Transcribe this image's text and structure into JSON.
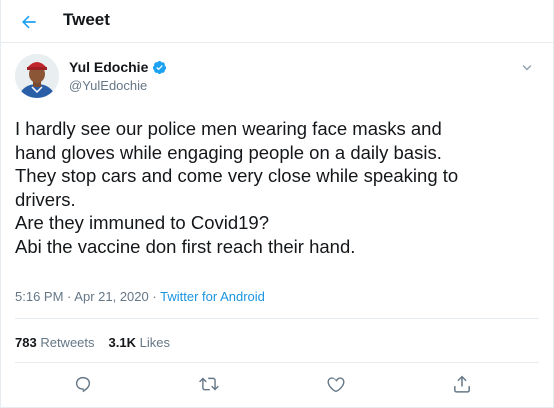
{
  "header": {
    "title": "Tweet",
    "back_icon": "arrow-left-icon"
  },
  "colors": {
    "accent": "#1b95e0",
    "text": "#14171a",
    "muted": "#657786",
    "border": "#e6ecf0"
  },
  "tweet": {
    "author": {
      "name": "Yul Edochie",
      "handle": "@YulEdochie",
      "verified": true
    },
    "text_lines": [
      "I hardly see our police men wearing face masks and",
      "hand gloves while engaging people on a daily basis.",
      "They stop cars and come very close while speaking to",
      "drivers.",
      "Are they immuned to Covid19?",
      "Abi the vaccine don first reach their hand."
    ],
    "time": "5:16 PM",
    "date": "Apr 21, 2020",
    "separator": "·",
    "source": "Twitter for Android",
    "stats": {
      "retweets_count": "783",
      "retweets_label": "Retweets",
      "likes_count": "3.1K",
      "likes_label": "Likes"
    },
    "actions": [
      "reply-icon",
      "retweet-icon",
      "like-icon",
      "share-icon"
    ]
  }
}
